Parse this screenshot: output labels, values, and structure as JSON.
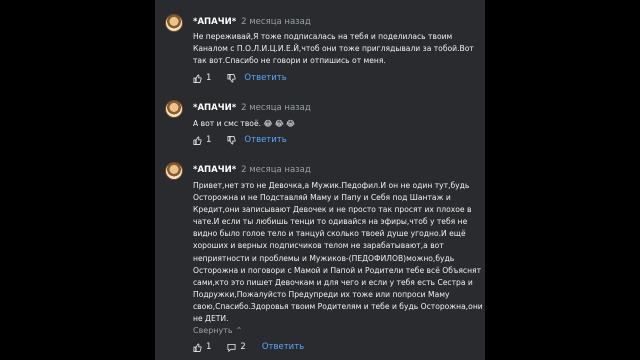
{
  "comments": [
    {
      "author": "*АПАЧИ*",
      "time": "2 месяца назад",
      "lines": [
        "Не переживай,Я тоже подписалась на тебя и поделилась твоим",
        "Каналом с П.О.Л.И.Ц.И.Е.Й,чтоб они тоже приглядывали за тобой.Вот",
        "так вот.Спасибо не говори и отпишись от меня."
      ],
      "likes": "1",
      "reply_label": "Ответить"
    },
    {
      "author": "*АПАЧИ*",
      "time": "2 месяца назад",
      "lines": [
        "А вот и смс твоё. 😂 😂 😂"
      ],
      "likes": "1",
      "reply_label": "Ответить"
    },
    {
      "author": "*АПАЧИ*",
      "time": "2 месяца назад",
      "lines": [
        "Привет,нет это не Девочка,а Мужик.Педофил.И он не один тут,будь",
        "Осторожна и не Подставляй Маму и Папу и Себя под Шантаж и",
        "Кредит,они записывают Девочек и не просто так просят их плохое в",
        "чате.И если ты любишь тенци то одивайся на эфиры,чтоб у тебя не",
        "видно было голое тело и танцуй сколько твоей душе угодно.И ещё",
        "хороших и верных подписчиков телом не зарабатывают,а вот",
        "неприятности и проблемы и Мужиков-(ПЕДОФИЛОВ)можно,будь",
        "Осторожна и поговори с Мамой и Папой и Родители тебе всё Объяснят",
        "сами,кто это пишет Девочкам и для чего и если у тебя есть Сестра и",
        "Подружки,Пожалуйсто Предупреди их тоже или попроси Маму",
        "свою,Спасибо.Здоровья твоим Родителям и тебе и будь Осторожна,они",
        "не ДЕТИ."
      ],
      "collapse_label": "Свернуть",
      "likes": "1",
      "replies": "2",
      "reply_label": "Ответить"
    }
  ]
}
